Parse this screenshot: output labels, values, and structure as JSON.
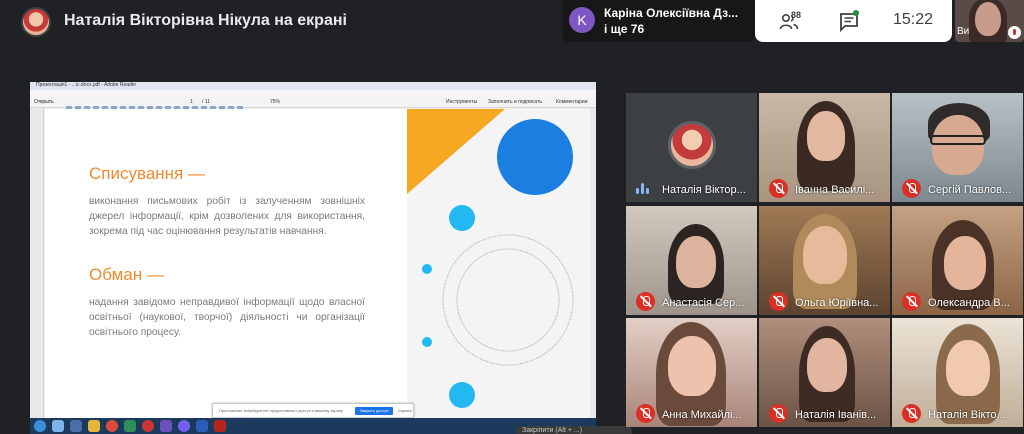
{
  "topbar": {
    "presenter_title": "Наталія Вікторівна Нікула на екрані",
    "notification": {
      "initial": "K",
      "name": "Каріна Олексіївна Дз...",
      "more": "і ще 76"
    },
    "people_count": "88",
    "time": "15:22",
    "self_label": "Ви"
  },
  "shared_screen": {
    "window_title": "Презентація1 - ...іс.docx.pdf - Adobe Reader",
    "menu": [
      "Файл",
      "Редагування",
      "Перегляд",
      "Вікно",
      "Справка"
    ],
    "toolbar": {
      "open": "Открыть",
      "page": "1",
      "page_total": "/ 11",
      "zoom": "75%",
      "tools": "Инструменты",
      "sign": "Заполнить и подписать",
      "comments": "Комментарии"
    },
    "slide": {
      "heading1": "Списування —",
      "text1": "виконання письмових робіт із залученням зовнішніх джерел інформації, крім дозволених для використання, зокрема під час оцінювання результатів навчання.",
      "heading2": "Обман —",
      "text2": "надання завідомо неправдивої інформації щодо власної освітньої (наукової, творчої) діяльності чи організації освітнього процесу."
    },
    "banner": {
      "text": "Приложение antiplagiat.net предоставляет доступ к вашему экрану",
      "button": "Закрыть доступ",
      "close": "Скрыть"
    }
  },
  "corner_tip": "Закріпити (Alt + ...)",
  "participants": [
    {
      "name": "Наталія Віктор...",
      "mic": "on"
    },
    {
      "name": "Іванна Василі...",
      "mic": "off"
    },
    {
      "name": "Сергій Павлов...",
      "mic": "off"
    },
    {
      "name": "Анастасія Сер...",
      "mic": "off"
    },
    {
      "name": "Ольга Юріївна...",
      "mic": "off"
    },
    {
      "name": "Олександра В...",
      "mic": "off"
    },
    {
      "name": "Анна Михайлі...",
      "mic": "off"
    },
    {
      "name": "Наталія Іванів...",
      "mic": "off"
    },
    {
      "name": "Наталія Вікто...",
      "mic": "off"
    }
  ],
  "colors": {
    "accent_orange": "#f08a31",
    "slide_blue": "#1a7fe0",
    "slide_cyan": "#24b8f2",
    "mic_off_red": "#d93025"
  }
}
